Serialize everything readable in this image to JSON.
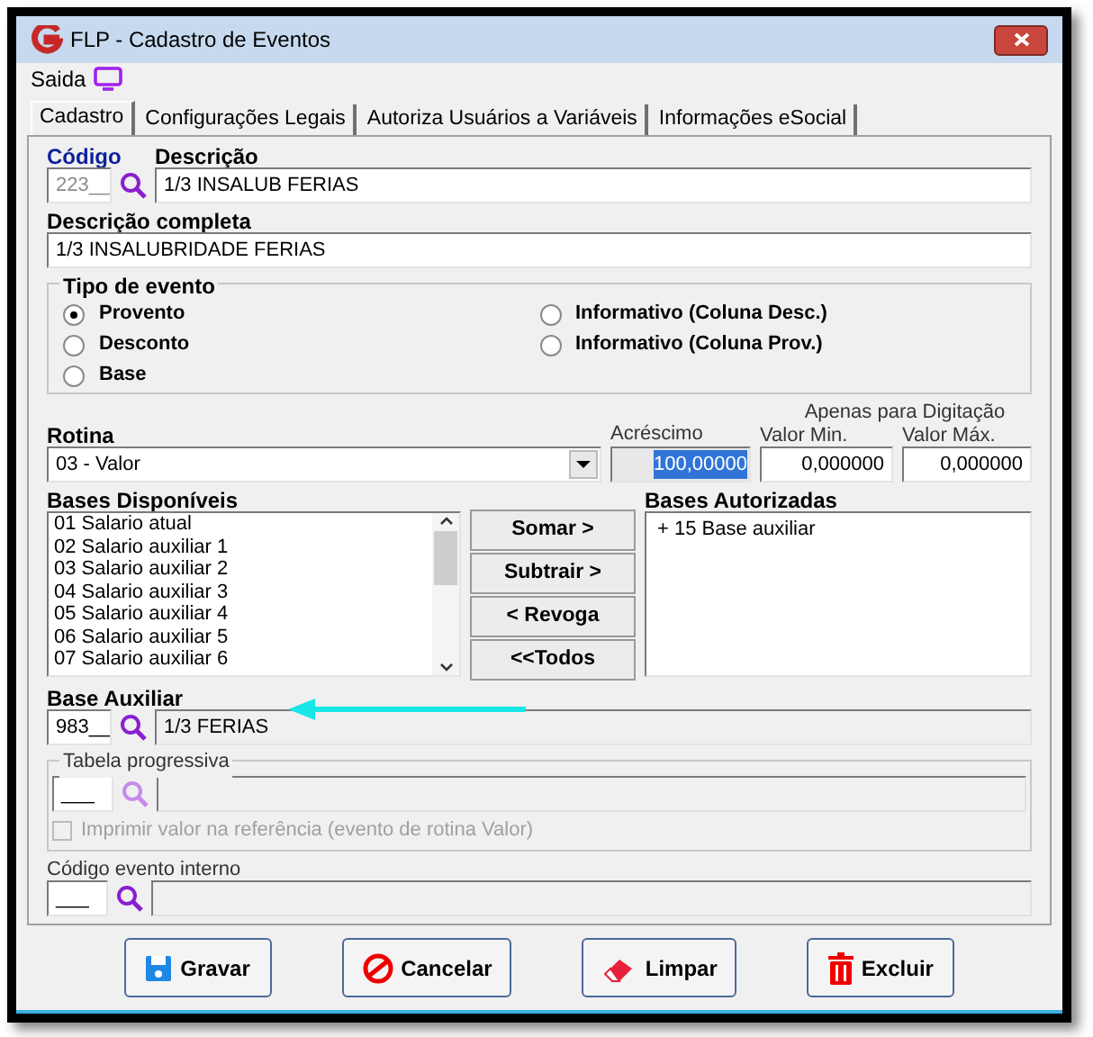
{
  "window": {
    "title": "FLP - Cadastro de Eventos"
  },
  "menu": [
    {
      "label": "Saida"
    }
  ],
  "tabs": [
    {
      "label": "Cadastro",
      "selected": true
    },
    {
      "label": "Configurações Legais",
      "selected": false
    },
    {
      "label": "Autoriza Usuários a Variáveis",
      "selected": false
    },
    {
      "label": "Informações eSocial",
      "selected": false
    }
  ],
  "codigo": {
    "label": "Código",
    "value": "223__",
    "disabled": true
  },
  "descricao": {
    "label": "Descrição",
    "value": "1/3 INSALUB FERIAS"
  },
  "descricao_completa": {
    "label": "Descrição completa",
    "value": "1/3 INSALUBRIDADE FERIAS"
  },
  "tipo_evento": {
    "title": "Tipo de evento",
    "options": [
      {
        "label": "Provento",
        "selected": true
      },
      {
        "label": "Desconto",
        "selected": false
      },
      {
        "label": "Base",
        "selected": false
      },
      {
        "label": "Informativo (Coluna Desc.)",
        "selected": false
      },
      {
        "label": "Informativo (Coluna Prov.)",
        "selected": false
      }
    ]
  },
  "rotina": {
    "label": "Rotina",
    "value": "03 - Valor"
  },
  "apenas_label": "Apenas para Digitação",
  "acrescimo": {
    "label": "Acréscimo",
    "value": "100,00000"
  },
  "valor_min": {
    "label": "Valor Min.",
    "value": "0,000000"
  },
  "valor_max": {
    "label": "Valor Máx.",
    "value": "0,000000"
  },
  "bases_disponiveis": {
    "label": "Bases Disponíveis",
    "items": [
      "01 Salario atual",
      "02 Salario auxiliar 1",
      "03 Salario auxiliar 2",
      "04 Salario auxiliar 3",
      "05 Salario auxiliar 4",
      "06 Salario auxiliar 5",
      "07 Salario auxiliar 6"
    ]
  },
  "actions": [
    "Somar >",
    "Subtrair >",
    "< Revoga",
    "<<Todos"
  ],
  "bases_autorizadas": {
    "label": "Bases Autorizadas",
    "items": [
      "+ 15 Base auxiliar"
    ]
  },
  "base_auxiliar": {
    "label": "Base Auxiliar",
    "code": "983__",
    "value": "1/3 FERIAS"
  },
  "tabela_progressiva": {
    "title": "Tabela progressiva",
    "code": "___",
    "checkbox": {
      "label": "Imprimir valor na referência (evento de rotina Valor)",
      "checked": false,
      "disabled": true
    }
  },
  "codigo_interno": {
    "label": "Código evento interno",
    "code": "___"
  },
  "buttons": [
    {
      "label": "Gravar",
      "kind": "save"
    },
    {
      "label": "Cancelar",
      "kind": "cancel"
    },
    {
      "label": "Limpar",
      "kind": "clear"
    },
    {
      "label": "Excluir",
      "kind": "delete"
    }
  ]
}
